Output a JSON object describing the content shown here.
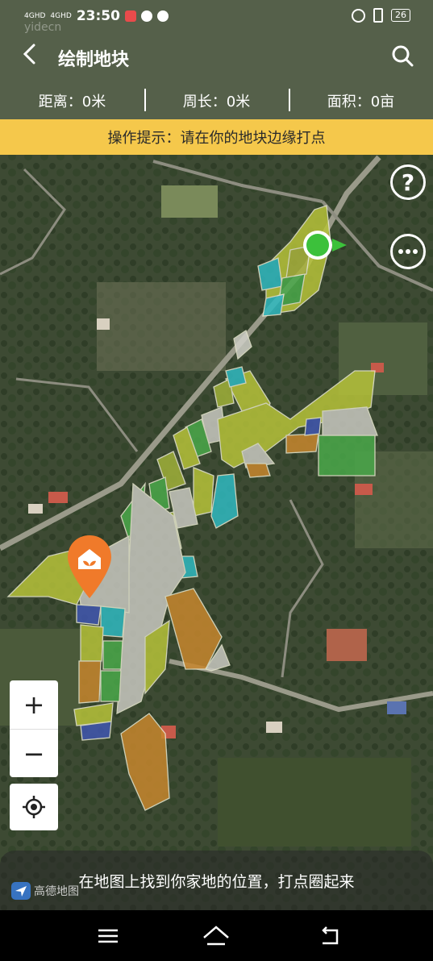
{
  "status": {
    "signal1": "4GHD",
    "signal2": "4GHD",
    "time": "23:50",
    "battery": "26"
  },
  "header": {
    "title": "绘制地块"
  },
  "metrics": [
    {
      "label": "距离：0米"
    },
    {
      "label": "周长：0米"
    },
    {
      "label": "面积：0亩"
    }
  ],
  "hint": "操作提示：请在你的地块边缘打点",
  "bottom_tip": "在地图上找到你家地的位置，打点圈起来",
  "map_provider": "高德地图",
  "watermark": "yidecn",
  "colors": {
    "hint_bg": "#f5c84b",
    "marker_green": "#3cc13b",
    "marker_orange": "#f07a2a"
  },
  "icons": {
    "back": "chevron-left-icon",
    "search": "search-icon",
    "help": "question-icon",
    "more": "ellipsis-icon",
    "zoom_in": "plus-icon",
    "zoom_out": "minus-icon",
    "locate": "crosshair-icon"
  }
}
